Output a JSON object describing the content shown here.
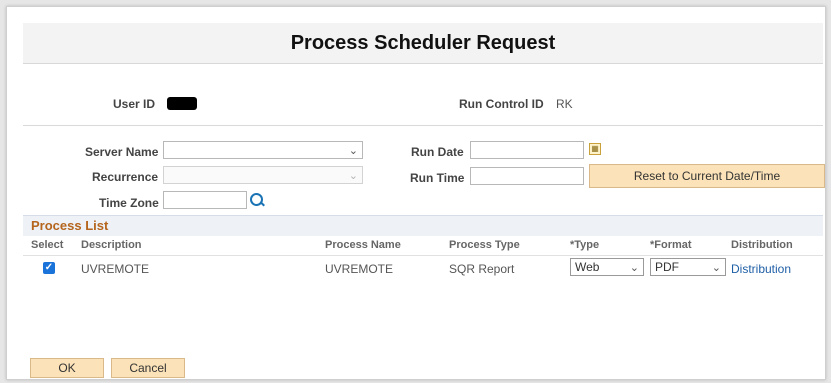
{
  "page": {
    "title": "Process Scheduler Request"
  },
  "info": {
    "user_id_label": "User ID",
    "run_control_label": "Run Control ID",
    "run_control_value": "RK"
  },
  "form": {
    "server_name_label": "Server Name",
    "server_name_value": "",
    "recurrence_label": "Recurrence",
    "recurrence_value": "",
    "time_zone_label": "Time Zone",
    "time_zone_value": "",
    "run_date_label": "Run Date",
    "run_date_value": "",
    "run_time_label": "Run Time",
    "run_time_value": "",
    "reset_button": "Reset to Current Date/Time"
  },
  "process_list": {
    "title": "Process List",
    "columns": {
      "select": "Select",
      "description": "Description",
      "process_name": "Process Name",
      "process_type": "Process Type",
      "type": "*Type",
      "format": "*Format",
      "distribution": "Distribution"
    },
    "rows": [
      {
        "selected": true,
        "description": "UVREMOTE",
        "process_name": "UVREMOTE",
        "process_type": "SQR Report",
        "type": "Web",
        "format": "PDF",
        "distribution": "Distribution"
      }
    ]
  },
  "actions": {
    "ok": "OK",
    "cancel": "Cancel"
  },
  "icons": {
    "dropdown": "chevron-down-icon",
    "calendar": "calendar-icon",
    "lookup": "magnifier-icon",
    "checkbox": "checkmark-icon"
  },
  "colors": {
    "button_bg": "#fbe2b8",
    "section_title": "#b5651d",
    "link": "#1f5fa6",
    "checkbox": "#1a73d9"
  }
}
